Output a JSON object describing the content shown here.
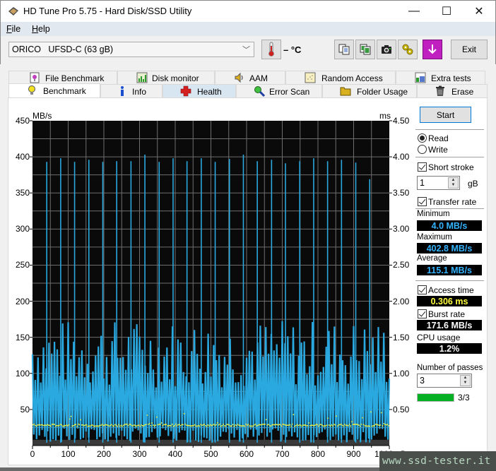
{
  "window": {
    "title": "HD Tune Pro 5.75 - Hard Disk/SSD Utility",
    "controls": {
      "minimize": "—",
      "maximize": "☐",
      "close": "✕"
    }
  },
  "menu": [
    {
      "label": "File",
      "accel": "F",
      "rest": "ile"
    },
    {
      "label": "Help",
      "accel": "H",
      "rest": "elp"
    }
  ],
  "toolbar": {
    "drive": "ORICO   UFSD-C (63 gB)",
    "temperature": "– °C",
    "buttons": [
      {
        "name": "copy-text-button",
        "icon": "copy-text-icon"
      },
      {
        "name": "copy-screenshot-button",
        "icon": "copy-image-icon"
      },
      {
        "name": "screenshot-button",
        "icon": "camera-icon"
      },
      {
        "name": "options-button",
        "icon": "options-icon"
      },
      {
        "name": "save-button",
        "icon": "download-arrow-icon"
      }
    ],
    "exit_label": "Exit"
  },
  "tabs": {
    "top_row": [
      {
        "label": "File Benchmark",
        "icon": "file-benchmark-icon"
      },
      {
        "label": "Disk monitor",
        "icon": "disk-monitor-icon"
      },
      {
        "label": "AAM",
        "icon": "speaker-icon"
      },
      {
        "label": "Random Access",
        "icon": "random-access-icon"
      },
      {
        "label": "Extra tests",
        "icon": "extra-tests-icon"
      }
    ],
    "bottom_row": [
      {
        "label": "Benchmark",
        "icon": "lightbulb-icon",
        "active": true
      },
      {
        "label": "Info",
        "icon": "info-icon"
      },
      {
        "label": "Health",
        "icon": "health-cross-icon"
      },
      {
        "label": "Error Scan",
        "icon": "magnifier-icon"
      },
      {
        "label": "Folder Usage",
        "icon": "folder-icon"
      },
      {
        "label": "Erase",
        "icon": "trash-icon"
      }
    ]
  },
  "side": {
    "start_label": "Start",
    "mode_read": "Read",
    "mode_write": "Write",
    "mode_selected": "read",
    "short_stroke_label": "Short stroke",
    "short_stroke_checked": true,
    "short_stroke_value": "1",
    "short_stroke_unit": "gB",
    "transfer_rate_label": "Transfer rate",
    "transfer_rate_checked": true,
    "minimum_label": "Minimum",
    "minimum_value": "4.0 MB/s",
    "maximum_label": "Maximum",
    "maximum_value": "402.8 MB/s",
    "average_label": "Average",
    "average_value": "115.1 MB/s",
    "access_time_label": "Access time",
    "access_time_checked": true,
    "access_time_value": "0.306 ms",
    "burst_rate_label": "Burst rate",
    "burst_rate_checked": true,
    "burst_rate_value": "171.6 MB/s",
    "cpu_label": "CPU usage",
    "cpu_value": "1.2%",
    "passes_label": "Number of passes",
    "passes_value": "3",
    "progress_fraction": 1.0,
    "progress_text": "3/3"
  },
  "colors": {
    "transfer_line": "#2aa8e0",
    "access_dots": "#f0f040",
    "chart_bg": "#0a0a0a",
    "grid": "#6e6e6e",
    "minimum_text": "#34b4ff",
    "access_text": "#ffff40",
    "burst_text": "#ffffff",
    "progress": "#06b025"
  },
  "watermark": "www.ssd-tester.it",
  "chart_data": {
    "type": "line",
    "title": "",
    "xlabel": "mB",
    "ylabel": "MB/s",
    "y2label": "ms",
    "xlim": [
      0,
      1000
    ],
    "ylim": [
      0,
      450
    ],
    "y2lim": [
      0,
      4.5
    ],
    "grid": true,
    "x_ticks": [
      "0",
      "100",
      "200",
      "300",
      "400",
      "500",
      "600",
      "700",
      "800",
      "900",
      "1000mB"
    ],
    "y_ticks": [
      "50",
      "100",
      "150",
      "200",
      "250",
      "300",
      "350",
      "400",
      "450"
    ],
    "y2_ticks": [
      "0.50",
      "1.00",
      "1.50",
      "2.00",
      "2.50",
      "3.00",
      "3.50",
      "4.00",
      "4.50"
    ],
    "series": [
      {
        "name": "Transfer rate",
        "axis": "left",
        "description": "oscillating transfer rate between ~4 and ~175 MB/s with periodic spikes near 390-403 MB/s",
        "spike_x": [
          40,
          79,
          118,
          158,
          197,
          236,
          276,
          315,
          355,
          394,
          433,
          473,
          512,
          552,
          591,
          630,
          670,
          709,
          749,
          788,
          827,
          866,
          906,
          945
        ],
        "spike_values": [
          393,
          398,
          393,
          396,
          393,
          394,
          394,
          403,
          393,
          398,
          394,
          398,
          393,
          397,
          403,
          394,
          396,
          391,
          394,
          398,
          394,
          396,
          392,
          369
        ],
        "baseline_min": 4,
        "baseline_max": 175,
        "average": 115.1,
        "maximum": 402.8,
        "minimum": 4.0
      },
      {
        "name": "Access time",
        "axis": "right",
        "description": "scatter of access times clustered near 0.30 ms",
        "typical_ms": 0.306
      }
    ],
    "legend": "none"
  }
}
